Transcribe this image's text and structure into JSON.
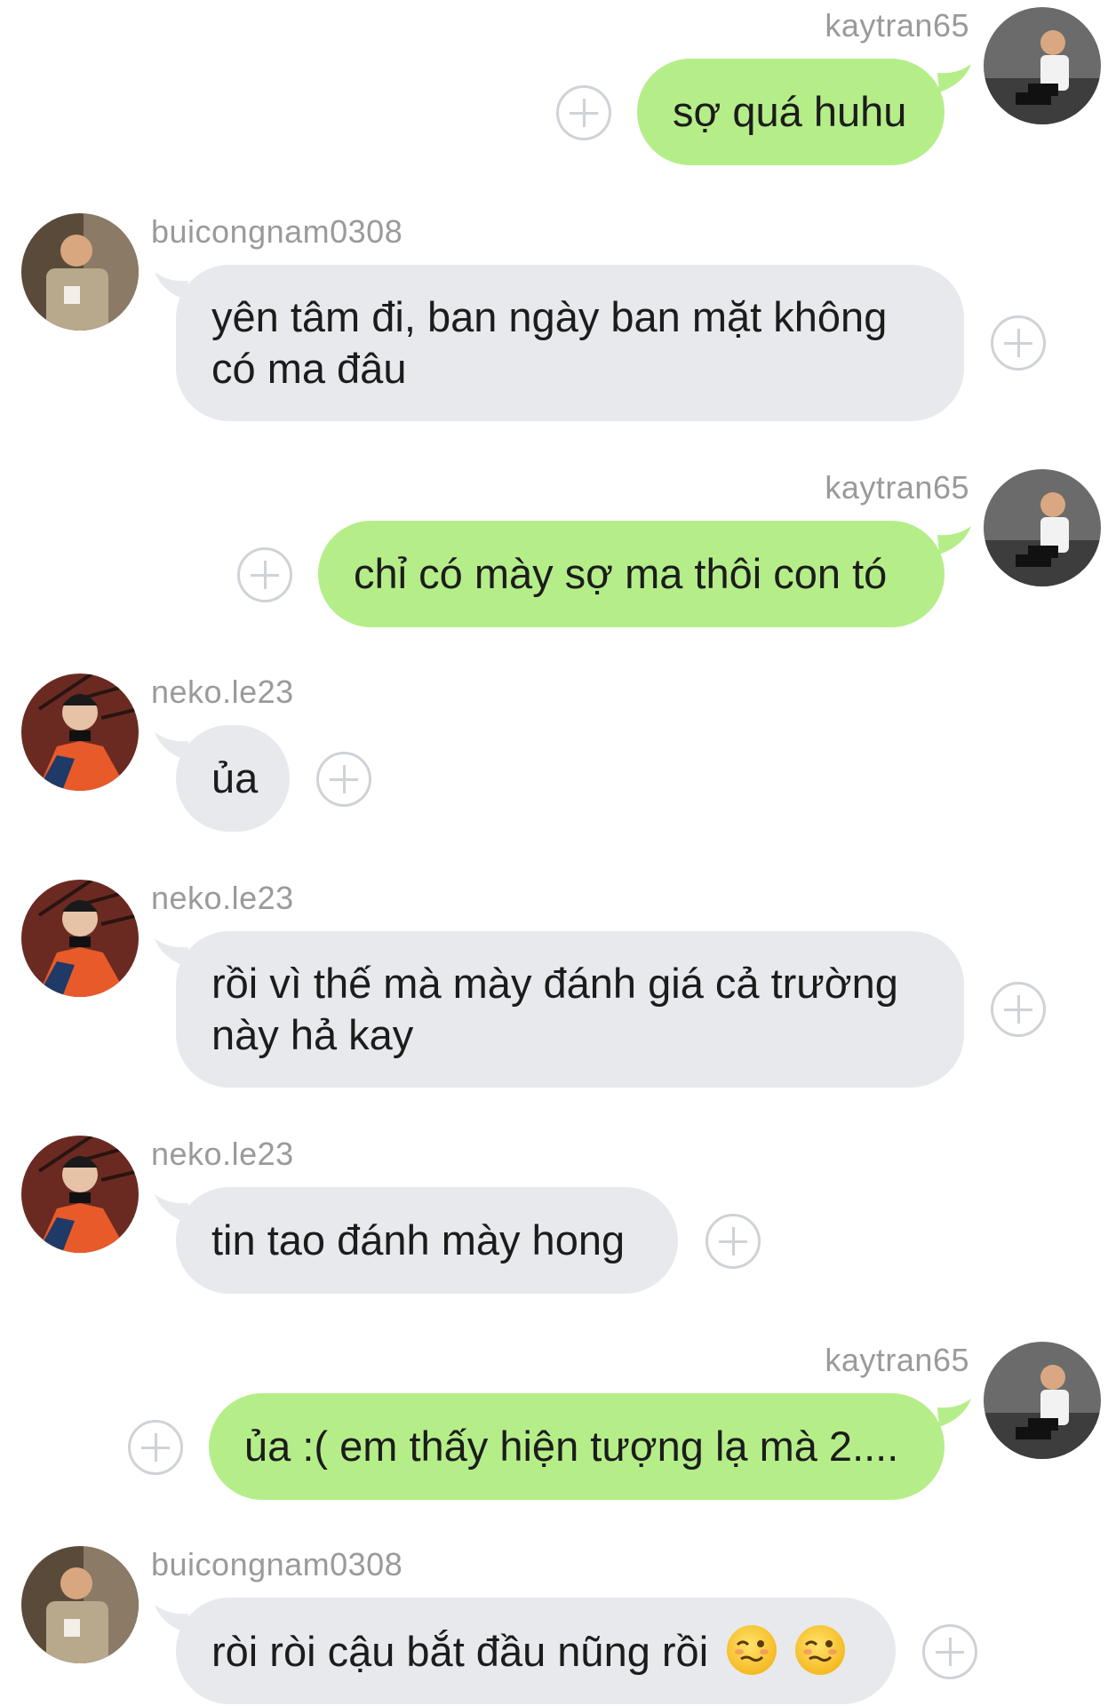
{
  "messages": [
    {
      "direction": "out",
      "user": "kaytran65",
      "text": "sợ quá huhu"
    },
    {
      "direction": "in",
      "user": "buicongnam0308",
      "text_lines": [
        "yên tâm đi, ban ngày ban mặt không",
        "có ma đâu"
      ]
    },
    {
      "direction": "out",
      "user": "kaytran65",
      "text": "chỉ có mày sợ ma thôi con tó"
    },
    {
      "direction": "in",
      "user": "neko.le23",
      "text": "ủa"
    },
    {
      "direction": "in",
      "user": "neko.le23",
      "text_lines": [
        "rồi vì thế mà mày đánh giá cả trường",
        "này hả kay"
      ]
    },
    {
      "direction": "in",
      "user": "neko.le23",
      "text": "tin tao đánh mày hong"
    },
    {
      "direction": "out",
      "user": "kaytran65",
      "text": "ủa :( em thấy hiện tượng lạ mà 2...."
    },
    {
      "direction": "in",
      "user": "buicongnam0308",
      "text": "ròi ròi cậu bắt đầu nũng rồi",
      "emoji": [
        "woozy-face-emoji",
        "woozy-face-emoji"
      ]
    }
  ],
  "colors": {
    "outgoing_bubble": "#b5ee89",
    "incoming_bubble": "#e7e9ed",
    "username": "#9a9a9a",
    "plus_icon": "#cfd2d6"
  },
  "icons": {
    "add_reaction": "plus-circle-icon"
  }
}
